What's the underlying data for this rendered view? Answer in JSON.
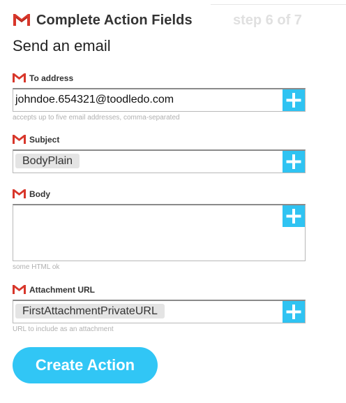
{
  "header": {
    "title": "Complete Action Fields",
    "step": "step 6 of 7"
  },
  "subtitle": "Send an email",
  "fields": [
    {
      "label": "To address",
      "value": "johndoe.654321@toodledo.com",
      "hint": "accepts up to five email addresses, comma-separated"
    },
    {
      "label": "Subject",
      "token": "BodyPlain"
    },
    {
      "label": "Body",
      "value": "",
      "hint": "some HTML ok"
    },
    {
      "label": "Attachment URL",
      "token": "FirstAttachmentPrivateURL",
      "hint": "URL to include as an attachment"
    }
  ],
  "create_action_label": "Create Action",
  "colors": {
    "accent": "#2fc3f2",
    "gmail_red": "#d8372b",
    "hint_text": "#b0b0b0"
  },
  "icons": {
    "service": "gmail-icon",
    "add_ingredient": "plus-icon"
  }
}
